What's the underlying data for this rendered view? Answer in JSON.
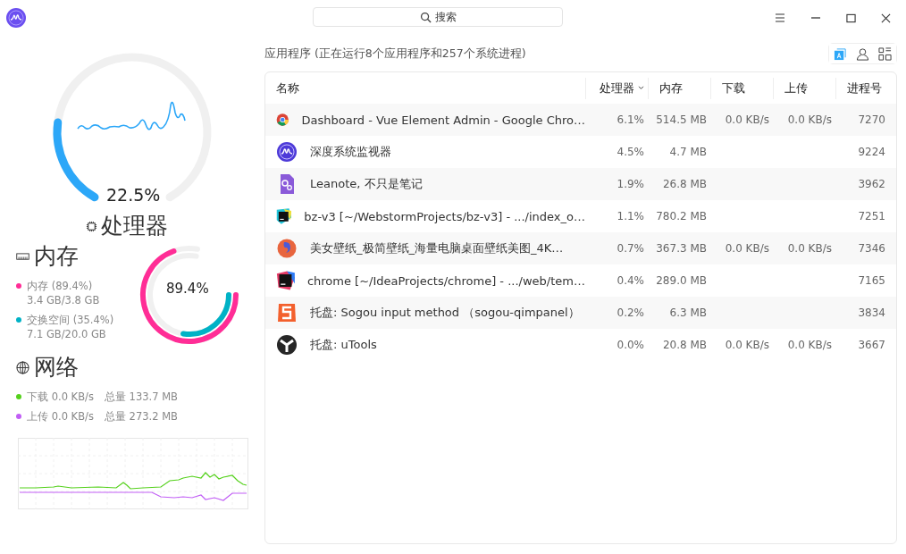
{
  "search": {
    "placeholder": "搜索"
  },
  "cpu": {
    "title": "处理器",
    "reading": "22.5%"
  },
  "memory": {
    "title": "内存",
    "reading": "89.4%",
    "items": [
      {
        "label": "内存 (89.4%)",
        "detail": "3.4 GB/3.8 GB",
        "color": "#ff2d96"
      },
      {
        "label": "交换空间 (35.4%)",
        "detail": "7.1 GB/20.0 GB",
        "color": "#00b2c6"
      }
    ]
  },
  "network": {
    "title": "网络",
    "items": [
      {
        "label": "下载 0.0 KB/s",
        "total": "总量 133.7 MB",
        "color": "#55d11c"
      },
      {
        "label": "上传 0.0 KB/s",
        "total": "总量 273.2 MB",
        "color": "#c15ef5"
      }
    ]
  },
  "summary": "应用程序 (正在运行8个应用程序和257个系统进程)",
  "view_buttons": [
    {
      "selected": true
    },
    {
      "selected": false
    },
    {
      "selected": false
    }
  ],
  "table": {
    "columns": [
      {
        "label": "名称",
        "sorted": false
      },
      {
        "label": "处理器",
        "sorted": true
      },
      {
        "label": "内存",
        "sorted": false
      },
      {
        "label": "下载",
        "sorted": false
      },
      {
        "label": "上传",
        "sorted": false
      },
      {
        "label": "进程号",
        "sorted": false
      }
    ],
    "rows": [
      {
        "name": "Dashboard - Vue Element Admin - Google Chro…",
        "cpu": "6.1%",
        "memory": "514.5 MB",
        "download": "0.0 KB/s",
        "upload": "0.0 KB/s",
        "pid": "7270"
      },
      {
        "name": "深度系统监视器",
        "cpu": "4.5%",
        "memory": "4.7 MB",
        "pid": "9224"
      },
      {
        "name": "Leanote, 不只是笔记",
        "cpu": "1.9%",
        "memory": "26.8 MB",
        "pid": "3962"
      },
      {
        "name": "bz-v3 [~/WebstormProjects/bz-v3] - .../index_o…",
        "cpu": "1.1%",
        "memory": "780.2 MB",
        "pid": "7251"
      },
      {
        "name": "美女壁纸_极简壁纸_海量电脑桌面壁纸美图_4K…",
        "cpu": "0.7%",
        "memory": "367.3 MB",
        "download": "0.0 KB/s",
        "upload": "0.0 KB/s",
        "pid": "7346"
      },
      {
        "name": "chrome [~/IdeaProjects/chrome] - .../web/tem…",
        "cpu": "0.4%",
        "memory": "289.0 MB",
        "pid": "7165"
      },
      {
        "name": "托盘: Sogou input method （sogou-qimpanel）",
        "cpu": "0.2%",
        "memory": "6.3 MB",
        "pid": "3834"
      },
      {
        "name": "托盘: uTools",
        "cpu": "0.0%",
        "memory": "20.8 MB",
        "download": "0.0 KB/s",
        "upload": "0.0 KB/s",
        "pid": "3667"
      }
    ]
  }
}
